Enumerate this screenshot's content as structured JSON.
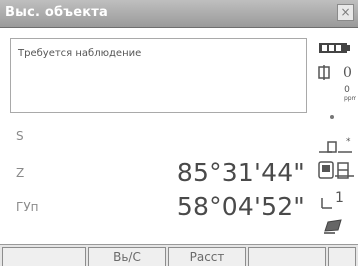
{
  "window": {
    "title": "Выс. объекта",
    "close_glyph": "×"
  },
  "message": "Требуется наблюдение",
  "measurements": [
    {
      "label": "S",
      "value": ""
    },
    {
      "label": "Z",
      "value": "85°31'44\""
    },
    {
      "label": "ГУп",
      "value": "58°04'52\""
    }
  ],
  "status_icons": {
    "battery": "battery-icon",
    "ppm_value": "0",
    "ppm_sub": "0",
    "prism_constant": "1"
  },
  "softkeys": [
    "",
    "Вь/С",
    "Расст",
    "",
    ""
  ],
  "colors": {
    "titlebar": "#a8a8a8",
    "text_value": "#4a4a4a",
    "text_label": "#8a8a8a"
  }
}
